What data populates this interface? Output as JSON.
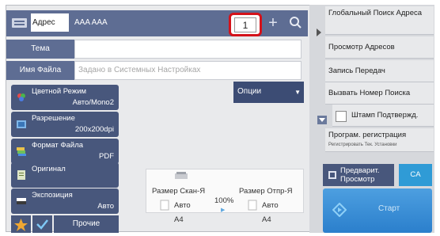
{
  "address": {
    "label": "Адрес",
    "value": "AAA AAA",
    "count": "1"
  },
  "fields": {
    "subject_label": "Тема",
    "subject_value": "",
    "filename_label": "Имя Файла",
    "filename_placeholder": "Задано в Системных Настройках"
  },
  "settings": [
    {
      "title": "Цветной Режим",
      "value": "Авто/Mono2"
    },
    {
      "title": "Разрешение",
      "value": "200x200dpi"
    },
    {
      "title": "Формат Файла",
      "value": "PDF"
    },
    {
      "title": "Оригинал",
      "value": ""
    },
    {
      "title": "Экспозиция",
      "value": "Авто"
    }
  ],
  "options_label": "Опции",
  "preview_panel": {
    "scan_size_label": "Размер Скан-Я",
    "scan_size_value": "Авто",
    "scan_paper": "A4",
    "ratio": "100%",
    "send_size_label": "Размер Отпр-Я",
    "send_size_value": "Авто",
    "send_paper": "A4"
  },
  "bottom": {
    "other_label": "Прочие"
  },
  "right_panel": {
    "items": [
      {
        "label": "Глобальный Поиск Адреса"
      },
      {
        "label": "Просмотр Адресов"
      },
      {
        "label": "Запись Передач"
      },
      {
        "label": "Вызвать Номер Поиска"
      },
      {
        "label": "Штамп Подтвержд."
      },
      {
        "label": "Програм. регистрация",
        "sub": "Регистрировать Тек. Установки"
      }
    ],
    "preview_label": "Предварит. Просмотр",
    "ca_label": "CA",
    "start_label": "Старт"
  },
  "colors": {
    "bar": "#5e6d93",
    "button": "#48577c",
    "highlight": "#d4121a",
    "start": "#2b7fcc"
  }
}
